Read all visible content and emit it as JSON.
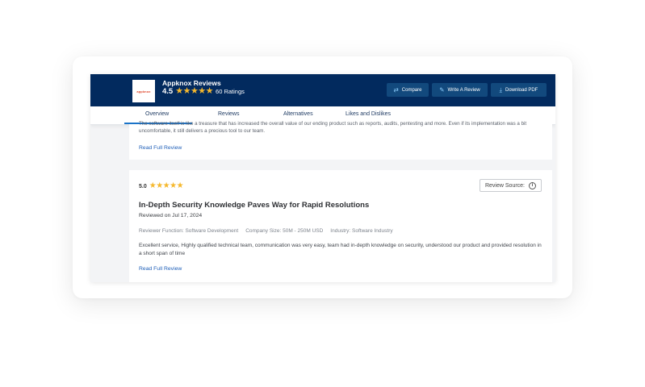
{
  "header": {
    "logo_text": "appknox",
    "product_title": "Appknox Reviews",
    "rating_value": "4.5",
    "rating_stars": 4.5,
    "rating_count": "60 Ratings",
    "buttons": {
      "compare": "Compare",
      "write": "Write A Review",
      "download": "Download PDF"
    },
    "icons": {
      "compare": "compare-arrows-icon",
      "write": "chat-pencil-icon",
      "download": "download-icon"
    }
  },
  "tabs": [
    {
      "label": "Overview",
      "active": true
    },
    {
      "label": "Reviews",
      "active": false
    },
    {
      "label": "Alternatives",
      "active": false
    },
    {
      "label": "Likes and Dislikes",
      "active": false
    }
  ],
  "reviews": [
    {
      "text": "The software itself is like a treasure that has increased the overall value of our ending product such as reports, audits, pentesting and more. Even if its implementation was a bit uncomfortable, it still delivers a precious tool to our team.",
      "read_more": "Read Full Review"
    },
    {
      "score": "5.0",
      "stars": 5,
      "source_label": "Review Source:",
      "title": "In-Depth Security Knowledge Paves Way for Rapid Resolutions",
      "date": "Reviewed on Jul 17, 2024",
      "meta": {
        "function": "Reviewer Function: Software Development",
        "company_size": "Company Size: 50M - 250M USD",
        "industry": "Industry: Software Industry"
      },
      "body": "Excellent service, Highly qualified technical team, communication was very easy, team had in-depth knowledge on security, understood our product and provided resolution in a short span of time",
      "read_more": "Read Full Review"
    }
  ],
  "colors": {
    "header_bg": "#022a5e",
    "star": "#f5b82e",
    "link": "#1f5fb8",
    "tab_underline": "#1a73c8"
  }
}
